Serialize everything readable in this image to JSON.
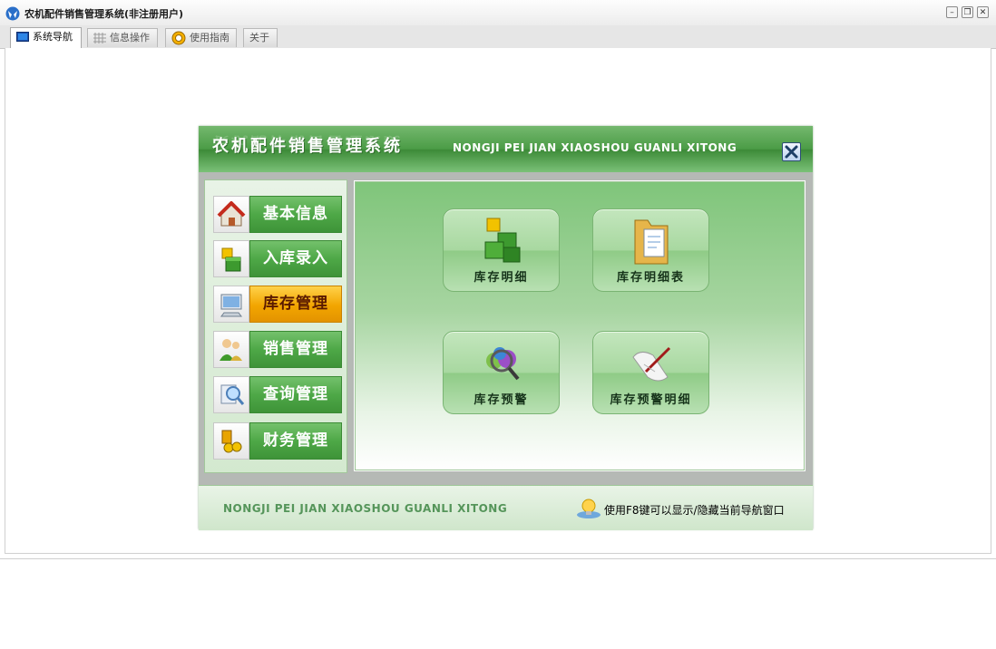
{
  "window": {
    "title": "农机配件销售管理系统(非注册用户)"
  },
  "tabs": [
    {
      "label": "系统导航",
      "icon": "monitor-icon",
      "active": true
    },
    {
      "label": "信息操作",
      "icon": "grid-icon",
      "active": false
    },
    {
      "label": "使用指南",
      "icon": "lifebuoy-icon",
      "active": false
    },
    {
      "label": "关于",
      "icon": "",
      "active": false
    }
  ],
  "nav": {
    "title": "农机配件销售管理系统",
    "subtitle": "NONGJI PEI JIAN XIAOSHOU GUANLI XITONG",
    "menu": [
      {
        "label": "基本信息",
        "icon": "house-icon",
        "active": false
      },
      {
        "label": "入库录入",
        "icon": "boxes-icon",
        "active": false
      },
      {
        "label": "库存管理",
        "icon": "computer-icon",
        "active": true
      },
      {
        "label": "销售管理",
        "icon": "user-group-icon",
        "active": false
      },
      {
        "label": "查询管理",
        "icon": "magnifier-icon",
        "active": false
      },
      {
        "label": "财务管理",
        "icon": "coins-icon",
        "active": false
      }
    ],
    "features": [
      {
        "label": "库存明细",
        "icon": "green-cubes-icon"
      },
      {
        "label": "库存明细表",
        "icon": "folder-documents-icon"
      },
      {
        "label": "库存预警",
        "icon": "search-globe-icon"
      },
      {
        "label": "库存预警明细",
        "icon": "scroll-pen-icon"
      }
    ],
    "footer": {
      "brand": "NONGJI PEI JIAN XIAOSHOU GUANLI XITONG",
      "hint": "使用F8键可以显示/隐藏当前导航窗口"
    }
  },
  "colors": {
    "accent_green": "#4ea847",
    "active_orange": "#f2a500",
    "header_green": "#4b9c46"
  }
}
